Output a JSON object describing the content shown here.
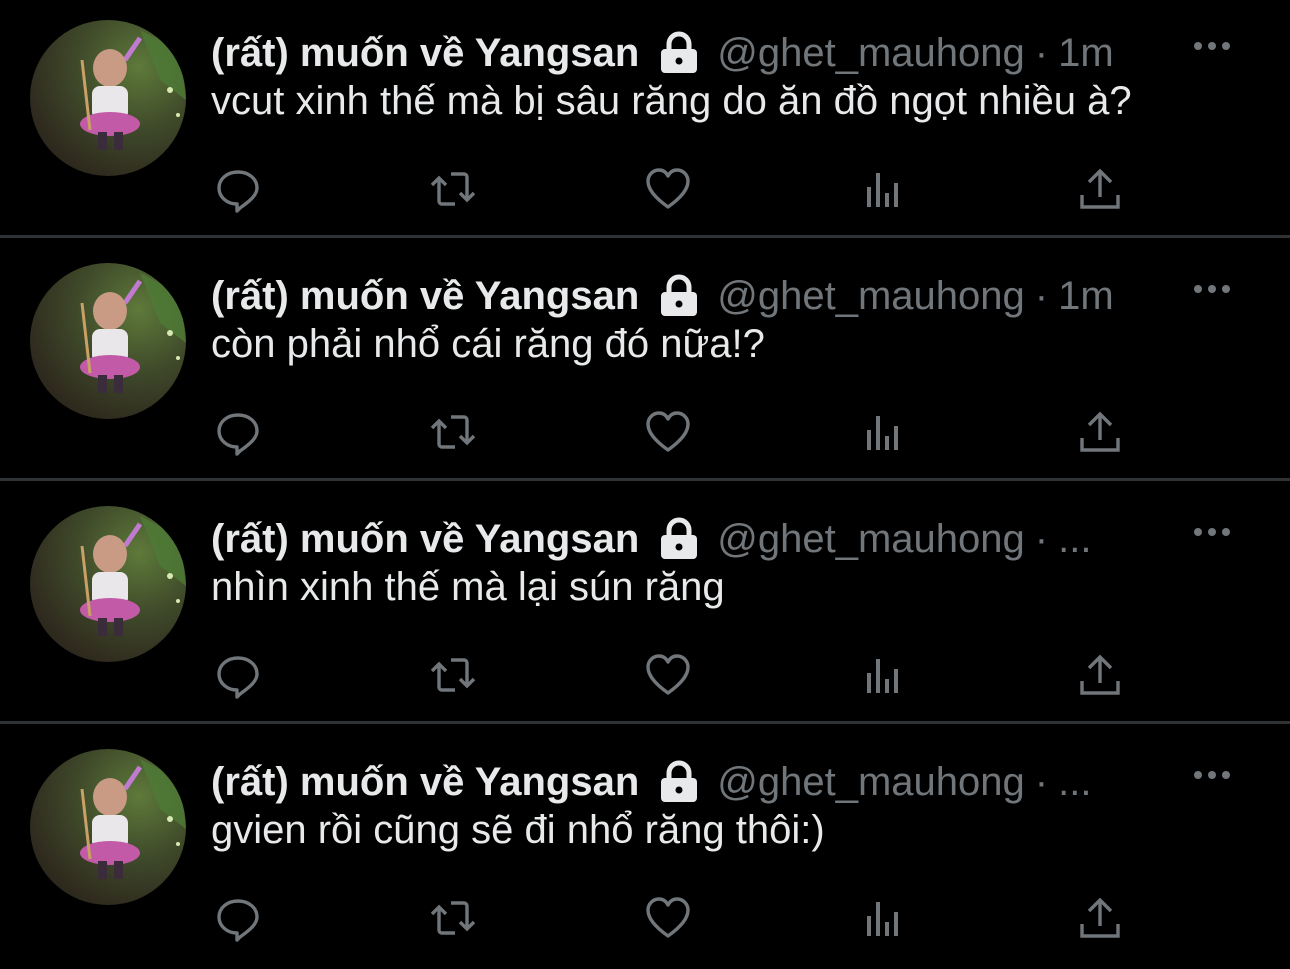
{
  "colors": {
    "background": "#000000",
    "text_primary": "#e7e9ea",
    "text_secondary": "#71767b",
    "divider": "#2f3336"
  },
  "icons": {
    "lock": "lock-icon",
    "more": "more-icon",
    "reply": "reply-icon",
    "retweet": "retweet-icon",
    "like": "heart-icon",
    "views": "views-icon",
    "share": "share-icon"
  },
  "tweets": [
    {
      "display_name": "(rất) muốn về Yangsan",
      "handle": "@ghet_mauhong",
      "separator": "·",
      "time": "1m",
      "text": "vcut xinh thế mà bị sâu răng do ăn đồ ngọt nhiều à?"
    },
    {
      "display_name": "(rất) muốn về Yangsan",
      "handle": "@ghet_mauhong",
      "separator": "·",
      "time": "1m",
      "text": "còn phải nhổ cái răng đó nữa!?"
    },
    {
      "display_name": "(rất) muốn về Yangsan",
      "handle": "@ghet_mauhong",
      "separator": "·",
      "time": "...",
      "text": "nhìn xinh thế mà lại sún răng"
    },
    {
      "display_name": "(rất) muốn về Yangsan",
      "handle": "@ghet_mauhong",
      "separator": "·",
      "time": "...",
      "text": "gvien rồi cũng sẽ đi nhổ răng thôi:)"
    }
  ]
}
